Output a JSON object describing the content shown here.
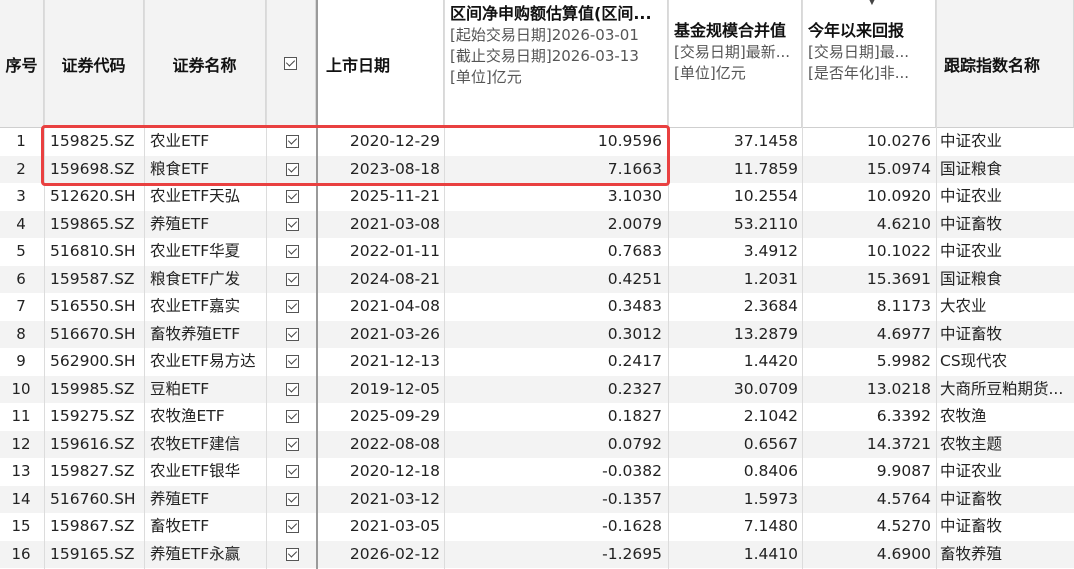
{
  "headers": {
    "idx": "序号",
    "code": "证券代码",
    "name": "证券名称",
    "date": "上市日期",
    "flow": {
      "title": "区间净申购额估算值(区间...",
      "lines": [
        "[起始交易日期]2026-03-01",
        "[截止交易日期]2026-03-13",
        "[单位]亿元"
      ]
    },
    "aum": {
      "title": "基金规模合并值",
      "lines": [
        "[交易日期]最新...",
        "[单位]亿元"
      ]
    },
    "ret": {
      "title": "今年以来回报",
      "lines": [
        "[交易日期]最...",
        "[是否年化]非..."
      ]
    },
    "index_name": "跟踪指数名称"
  },
  "rows": [
    {
      "idx": "1",
      "code": "159825.SZ",
      "name": "农业ETF",
      "date": "2020-12-29",
      "flow": "10.9596",
      "aum": "37.1458",
      "ret": "10.0276",
      "index": "中证农业"
    },
    {
      "idx": "2",
      "code": "159698.SZ",
      "name": "粮食ETF",
      "date": "2023-08-18",
      "flow": "7.1663",
      "aum": "11.7859",
      "ret": "15.0974",
      "index": "国证粮食"
    },
    {
      "idx": "3",
      "code": "512620.SH",
      "name": "农业ETF天弘",
      "date": "2025-11-21",
      "flow": "3.1030",
      "aum": "10.2554",
      "ret": "10.0920",
      "index": "中证农业"
    },
    {
      "idx": "4",
      "code": "159865.SZ",
      "name": "养殖ETF",
      "date": "2021-03-08",
      "flow": "2.0079",
      "aum": "53.2110",
      "ret": "4.6210",
      "index": "中证畜牧"
    },
    {
      "idx": "5",
      "code": "516810.SH",
      "name": "农业ETF华夏",
      "date": "2022-01-11",
      "flow": "0.7683",
      "aum": "3.4912",
      "ret": "10.1022",
      "index": "中证农业"
    },
    {
      "idx": "6",
      "code": "159587.SZ",
      "name": "粮食ETF广发",
      "date": "2024-08-21",
      "flow": "0.4251",
      "aum": "1.2031",
      "ret": "15.3691",
      "index": "国证粮食"
    },
    {
      "idx": "7",
      "code": "516550.SH",
      "name": "农业ETF嘉实",
      "date": "2021-04-08",
      "flow": "0.3483",
      "aum": "2.3684",
      "ret": "8.1173",
      "index": "大农业"
    },
    {
      "idx": "8",
      "code": "516670.SH",
      "name": "畜牧养殖ETF",
      "date": "2021-03-26",
      "flow": "0.3012",
      "aum": "13.2879",
      "ret": "4.6977",
      "index": "中证畜牧"
    },
    {
      "idx": "9",
      "code": "562900.SH",
      "name": "农业ETF易方达",
      "date": "2021-12-13",
      "flow": "0.2417",
      "aum": "1.4420",
      "ret": "5.9982",
      "index": "CS现代农"
    },
    {
      "idx": "10",
      "code": "159985.SZ",
      "name": "豆粕ETF",
      "date": "2019-12-05",
      "flow": "0.2327",
      "aum": "30.0709",
      "ret": "13.0218",
      "index": "大商所豆粕期货..."
    },
    {
      "idx": "11",
      "code": "159275.SZ",
      "name": "农牧渔ETF",
      "date": "2025-09-29",
      "flow": "0.1827",
      "aum": "2.1042",
      "ret": "6.3392",
      "index": "农牧渔"
    },
    {
      "idx": "12",
      "code": "159616.SZ",
      "name": "农牧ETF建信",
      "date": "2022-08-08",
      "flow": "0.0792",
      "aum": "0.6567",
      "ret": "14.3721",
      "index": "农牧主题"
    },
    {
      "idx": "13",
      "code": "159827.SZ",
      "name": "农业ETF银华",
      "date": "2020-12-18",
      "flow": "-0.0382",
      "aum": "0.8406",
      "ret": "9.9087",
      "index": "中证农业"
    },
    {
      "idx": "14",
      "code": "516760.SH",
      "name": "养殖ETF",
      "date": "2021-03-12",
      "flow": "-0.1357",
      "aum": "1.5973",
      "ret": "4.5764",
      "index": "中证畜牧"
    },
    {
      "idx": "15",
      "code": "159867.SZ",
      "name": "畜牧ETF",
      "date": "2021-03-05",
      "flow": "-0.1628",
      "aum": "7.1480",
      "ret": "4.5270",
      "index": "中证畜牧"
    },
    {
      "idx": "16",
      "code": "159165.SZ",
      "name": "养殖ETF永赢",
      "date": "2026-02-12",
      "flow": "-1.2695",
      "aum": "1.4410",
      "ret": "4.6900",
      "index": "畜牧养殖"
    }
  ],
  "colors": {
    "highlight": "#e94040",
    "alt_row": "#f3f3f3",
    "header_gray": "#f3f3f3"
  }
}
